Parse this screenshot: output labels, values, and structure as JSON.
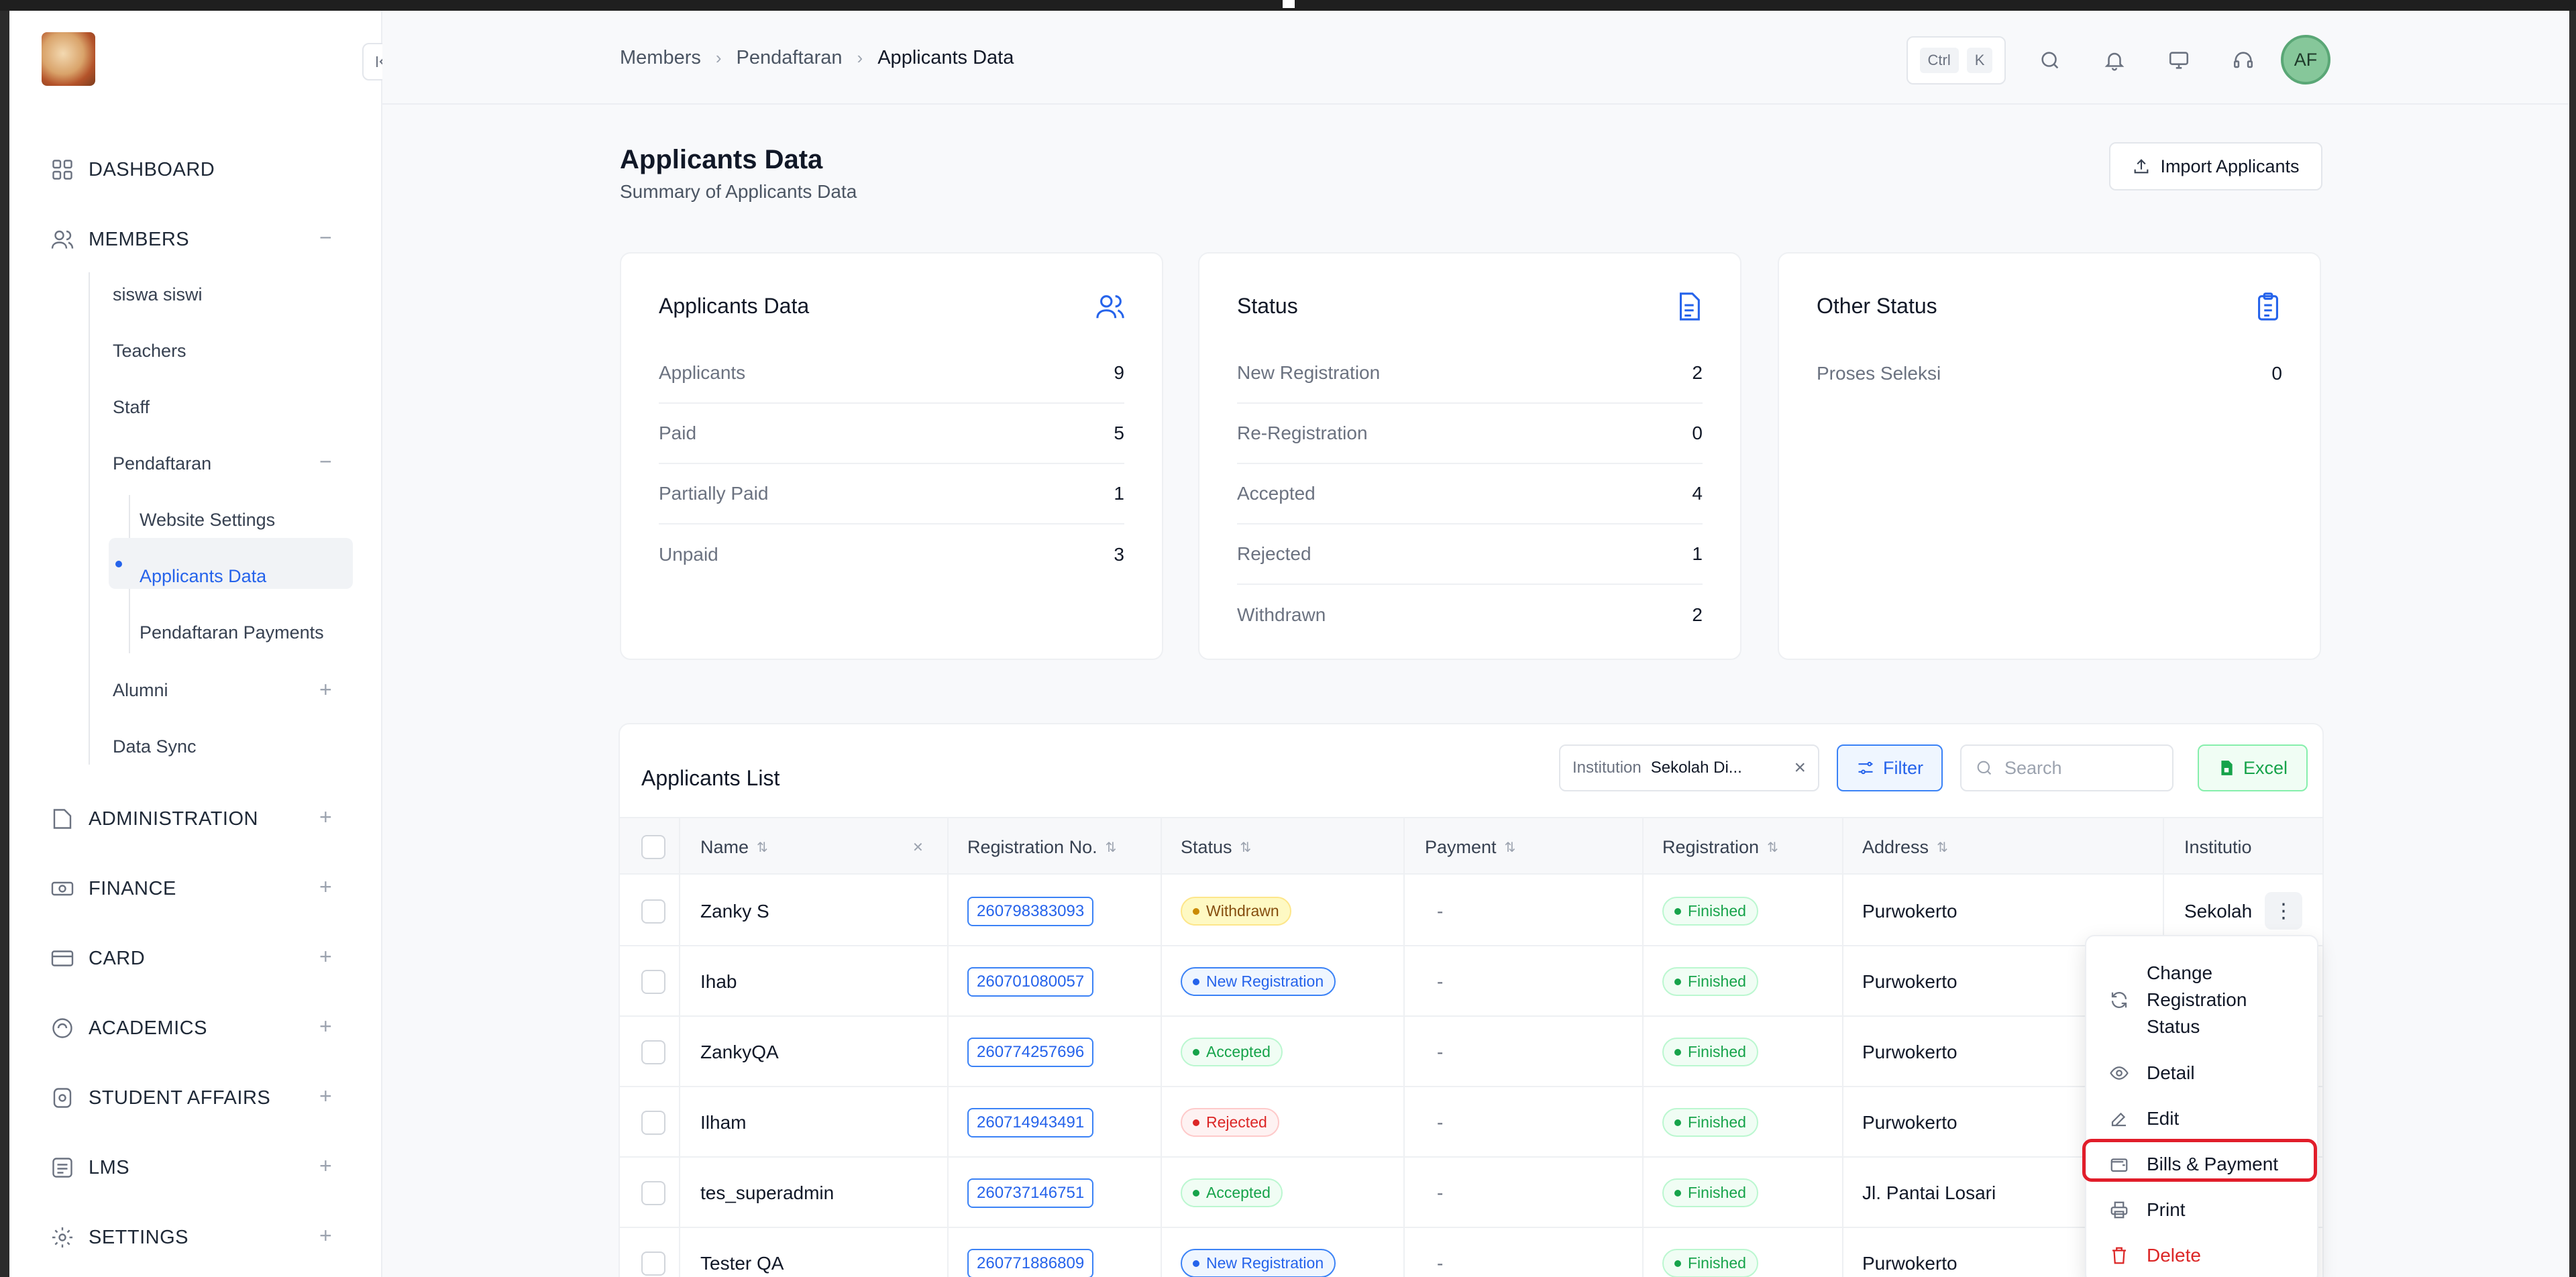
{
  "header": {
    "breadcrumbs": [
      "Members",
      "Pendaftaran",
      "Applicants Data"
    ],
    "shortcut_ctrl": "Ctrl",
    "shortcut_k": "K",
    "avatar_initials": "AF"
  },
  "sidebar": {
    "main": [
      {
        "label": "DASHBOARD",
        "icon": "grid-icon",
        "toggle": ""
      },
      {
        "label": "MEMBERS",
        "icon": "users-icon",
        "toggle": "−"
      },
      {
        "label": "ADMINISTRATION",
        "icon": "folder-icon",
        "toggle": "+"
      },
      {
        "label": "FINANCE",
        "icon": "money-icon",
        "toggle": "+"
      },
      {
        "label": "CARD",
        "icon": "card-icon",
        "toggle": "+"
      },
      {
        "label": "ACADEMICS",
        "icon": "academic-icon",
        "toggle": "+"
      },
      {
        "label": "STUDENT AFFAIRS",
        "icon": "badge-icon",
        "toggle": "+"
      },
      {
        "label": "LMS",
        "icon": "list-icon",
        "toggle": "+"
      },
      {
        "label": "SETTINGS",
        "icon": "gear-icon",
        "toggle": "+"
      }
    ],
    "members_sub": [
      "siswa siswi",
      "Teachers",
      "Staff",
      "Pendaftaran",
      "Alumni",
      "Data Sync"
    ],
    "pendaftaran_sub": [
      "Website Settings",
      "Applicants Data",
      "Pendaftaran Payments"
    ],
    "pendaftaran_toggle": "−",
    "alumni_toggle": "+"
  },
  "page": {
    "title": "Applicants Data",
    "subtitle": "Summary of Applicants Data",
    "import_label": "Import Applicants"
  },
  "cards": [
    {
      "title": "Applicants Data",
      "icon": "users-icon",
      "rows": [
        {
          "label": "Applicants",
          "value": "9"
        },
        {
          "label": "Paid",
          "value": "5"
        },
        {
          "label": "Partially Paid",
          "value": "1"
        },
        {
          "label": "Unpaid",
          "value": "3"
        }
      ]
    },
    {
      "title": "Status",
      "icon": "document-icon",
      "rows": [
        {
          "label": "New Registration",
          "value": "2"
        },
        {
          "label": "Re-Registration",
          "value": "0"
        },
        {
          "label": "Accepted",
          "value": "4"
        },
        {
          "label": "Rejected",
          "value": "1"
        },
        {
          "label": "Withdrawn",
          "value": "2"
        }
      ]
    },
    {
      "title": "Other Status",
      "icon": "clipboard-icon",
      "rows": [
        {
          "label": "Proses Seleksi",
          "value": "0"
        }
      ]
    }
  ],
  "table": {
    "title": "Applicants List",
    "institution_key": "Institution",
    "institution_value": "Sekolah Di...",
    "filter_label": "Filter",
    "search_placeholder": "Search",
    "excel_label": "Excel",
    "columns": [
      "Name",
      "Registration No.",
      "Status",
      "Payment",
      "Registration",
      "Address",
      "Institutio"
    ],
    "rows": [
      {
        "name": "Zanky S",
        "reg": "260798383093",
        "status": "Withdrawn",
        "status_kind": "withdrawn",
        "payment": "-",
        "registration": "Finished",
        "address": "Purwokerto",
        "institution": "Sekolah"
      },
      {
        "name": "Ihab",
        "reg": "260701080057",
        "status": "New Registration",
        "status_kind": "new",
        "payment": "-",
        "registration": "Finished",
        "address": "Purwokerto",
        "institution": ""
      },
      {
        "name": "ZankyQA",
        "reg": "260774257696",
        "status": "Accepted",
        "status_kind": "accepted",
        "payment": "-",
        "registration": "Finished",
        "address": "Purwokerto",
        "institution": ""
      },
      {
        "name": "Ilham",
        "reg": "260714943491",
        "status": "Rejected",
        "status_kind": "rejected",
        "payment": "-",
        "registration": "Finished",
        "address": "Purwokerto",
        "institution": ""
      },
      {
        "name": "tes_superadmin",
        "reg": "260737146751",
        "status": "Accepted",
        "status_kind": "accepted",
        "payment": "-",
        "registration": "Finished",
        "address": "Jl. Pantai Losari",
        "institution": ""
      },
      {
        "name": "Tester QA",
        "reg": "260771886809",
        "status": "New Registration",
        "status_kind": "new",
        "payment": "-",
        "registration": "Finished",
        "address": "Purwokerto",
        "institution": ""
      }
    ]
  },
  "menu": {
    "items": [
      {
        "label": "Change Registration Status",
        "icon": "refresh-icon"
      },
      {
        "label": "Detail",
        "icon": "eye-icon"
      },
      {
        "label": "Edit",
        "icon": "edit-icon"
      },
      {
        "label": "Bills & Payment",
        "icon": "wallet-icon"
      },
      {
        "label": "Print",
        "icon": "printer-icon"
      },
      {
        "label": "Delete",
        "icon": "trash-icon"
      }
    ]
  },
  "colors": {
    "accent": "#2563eb",
    "highlight": "#e11d2a",
    "success": "#16a34a",
    "danger": "#dc2626"
  }
}
